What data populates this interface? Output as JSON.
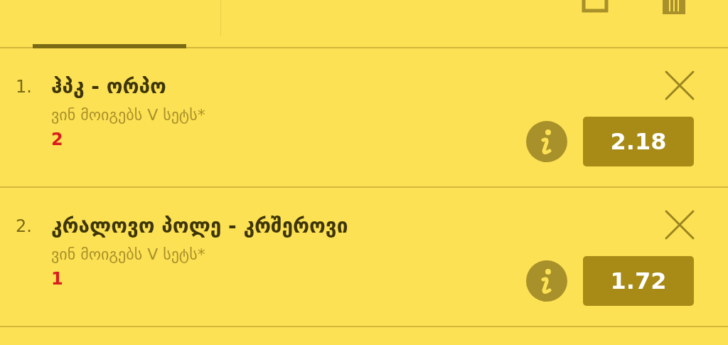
{
  "bets": [
    {
      "number": "1.",
      "match": "ჰპკ - ორპო",
      "market": "ვინ მოიგებს V სეტს*",
      "pick": "2",
      "odds": "2.18"
    },
    {
      "number": "2.",
      "match": "კრალოვო პოლე - კრშეროვი",
      "market": "ვინ მოიგებს V სეტს*",
      "pick": "1",
      "odds": "1.72"
    }
  ]
}
